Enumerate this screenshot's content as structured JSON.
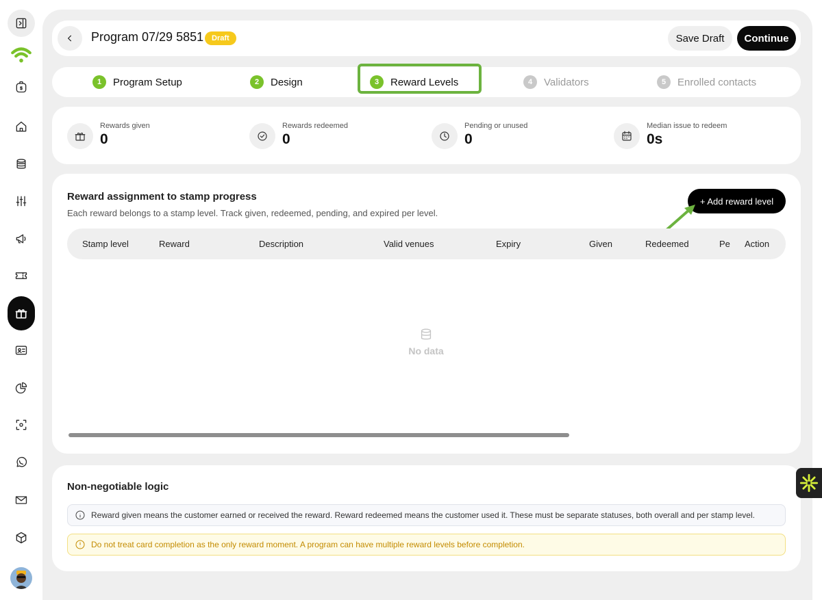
{
  "sidebar": {
    "items": [
      {
        "name": "sidebar-toggle",
        "icon": "panel-toggle-icon"
      },
      {
        "name": "sidebar-logo",
        "icon": "wifi-logo-icon"
      },
      {
        "name": "sidebar-item-billing",
        "icon": "dollar-bag-icon"
      },
      {
        "name": "sidebar-item-home",
        "icon": "home-icon"
      },
      {
        "name": "sidebar-item-database",
        "icon": "database-icon"
      },
      {
        "name": "sidebar-item-settings",
        "icon": "sliders-icon"
      },
      {
        "name": "sidebar-item-campaigns",
        "icon": "megaphone-icon"
      },
      {
        "name": "sidebar-item-tickets",
        "icon": "ticket-icon"
      },
      {
        "name": "sidebar-item-rewards",
        "icon": "gift-icon",
        "active": true
      },
      {
        "name": "sidebar-item-contacts",
        "icon": "id-card-icon"
      },
      {
        "name": "sidebar-item-reports",
        "icon": "pie-chart-icon"
      },
      {
        "name": "sidebar-item-scan",
        "icon": "scan-icon"
      },
      {
        "name": "sidebar-item-whatsapp",
        "icon": "whatsapp-icon"
      },
      {
        "name": "sidebar-item-mail",
        "icon": "mail-icon"
      },
      {
        "name": "sidebar-item-products",
        "icon": "cube-icon"
      }
    ],
    "brand_color": "#7ac22b"
  },
  "header": {
    "title": "Program 07/29 5851",
    "badge": "Draft",
    "save_label": "Save Draft",
    "continue_label": "Continue"
  },
  "steps": [
    {
      "num": "1",
      "label": "Program Setup",
      "state": "done"
    },
    {
      "num": "2",
      "label": "Design",
      "state": "done"
    },
    {
      "num": "3",
      "label": "Reward Levels",
      "state": "active"
    },
    {
      "num": "4",
      "label": "Validators",
      "state": "todo"
    },
    {
      "num": "5",
      "label": "Enrolled contacts",
      "state": "todo"
    }
  ],
  "stats": [
    {
      "label": "Rewards given",
      "value": "0",
      "icon": "gift-icon"
    },
    {
      "label": "Rewards redeemed",
      "value": "0",
      "icon": "check-circle-icon"
    },
    {
      "label": "Pending or unused",
      "value": "0",
      "icon": "clock-icon"
    },
    {
      "label": "Median issue to redeem",
      "value": "0s",
      "icon": "calendar-icon"
    }
  ],
  "rewards": {
    "title": "Reward assignment to stamp progress",
    "subtitle": "Each reward belongs to a stamp level. Track given, redeemed, pending, and expired per level.",
    "add_label": "+ Add reward level",
    "columns": [
      "Stamp level",
      "Reward",
      "Description",
      "Valid venues",
      "Expiry",
      "Given",
      "Redeemed",
      "Pe",
      "Action"
    ],
    "empty_text": "No data"
  },
  "logic": {
    "title": "Non-negotiable logic",
    "info_note": "Reward given means the customer earned or received the reward. Reward redeemed means the customer used it. These must be separate statuses, both overall and per stamp level.",
    "warn_note": "Do not treat card completion as the only reward moment. A program can have multiple reward levels before completion."
  },
  "colors": {
    "accent_green": "#7ac22b",
    "highlight_green": "#6cb33f",
    "draft_yellow": "#f6c91c",
    "warn_text": "#c38b00"
  }
}
